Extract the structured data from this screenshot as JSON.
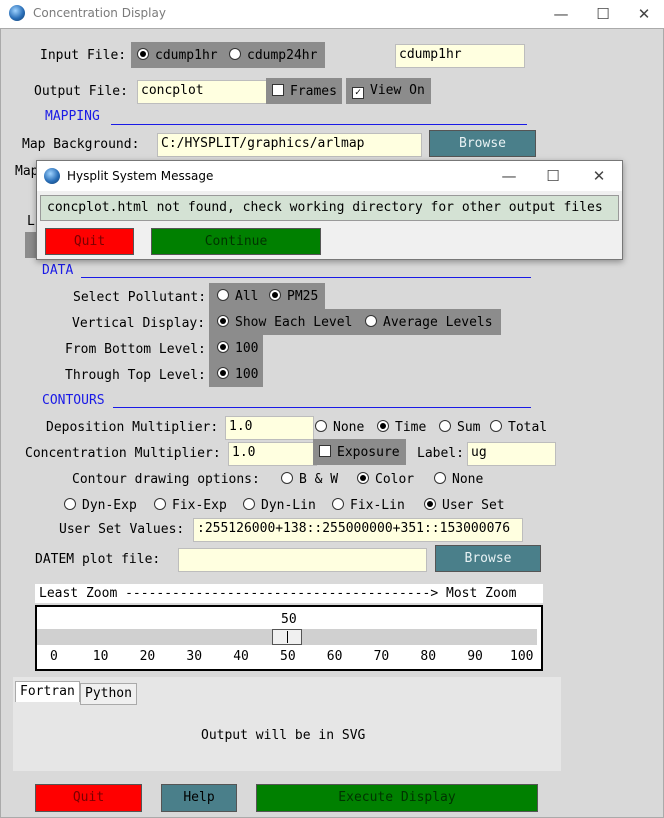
{
  "window": {
    "title": "Concentration Display",
    "minimize": "—",
    "maximize": "☐",
    "close": "✕"
  },
  "input": {
    "label": "Input File:",
    "options": [
      "cdump1hr",
      "cdump24hr"
    ],
    "selected": 0,
    "value": "cdump1hr"
  },
  "output": {
    "label": "Output File:",
    "value": "concplot",
    "frames_label": "Frames",
    "frames_checked": false,
    "viewon_label": "View On",
    "viewon_checked": true
  },
  "mapping": {
    "header": "MAPPING",
    "background_label": "Map Background:",
    "background_value": "C:/HYSPLIT/graphics/arlmap",
    "browse": "Browse",
    "partial1": "Map",
    "partial2": "L"
  },
  "dialog": {
    "title": "Hysplit System Message",
    "message": "concplot.html not found, check working directory for other output files",
    "quit": "Quit",
    "continue": "Continue"
  },
  "data": {
    "header": "DATA",
    "pollutant_label": "Select Pollutant:",
    "pollutant_options": [
      "All",
      "PM25"
    ],
    "pollutant_selected": 1,
    "vertical_label": "Vertical Display:",
    "vertical_options": [
      "Show Each Level",
      "Average Levels"
    ],
    "vertical_selected": 0,
    "bottom_label": "From Bottom Level:",
    "bottom_value": "100",
    "top_label": "Through Top Level:",
    "top_value": "100"
  },
  "contours": {
    "header": "CONTOURS",
    "deposition_label": "Deposition Multiplier:",
    "deposition_value": "1.0",
    "dep_options": [
      "None",
      "Time",
      "Sum",
      "Total"
    ],
    "dep_selected": 1,
    "conc_label": "Concentration Multiplier:",
    "conc_value": "1.0",
    "exposure_label": "Exposure",
    "exposure_checked": false,
    "label_label": "Label:",
    "label_value": "ug",
    "drawing_label": "Contour drawing options:",
    "drawing_options": [
      "B & W",
      "Color",
      "None"
    ],
    "drawing_selected": 1,
    "interval_options": [
      "Dyn-Exp",
      "Fix-Exp",
      "Dyn-Lin",
      "Fix-Lin",
      "User Set"
    ],
    "interval_selected": 4,
    "userset_label": "User Set Values:",
    "userset_value": ":255126000+138::255000000+351::153000076"
  },
  "datem": {
    "label": "DATEM plot file:",
    "value": "",
    "browse": "Browse"
  },
  "zoom": {
    "header": "Least Zoom ---------------------------------------> Most Zoom",
    "value": "50",
    "value_fraction": 0.5,
    "ticks": [
      "0",
      "10",
      "20",
      "30",
      "40",
      "50",
      "60",
      "70",
      "80",
      "90",
      "100"
    ]
  },
  "tabs": {
    "items": [
      "Fortran",
      "Python"
    ],
    "active": 0,
    "content": "Output will be in SVG"
  },
  "footer": {
    "quit": "Quit",
    "help": "Help",
    "execute": "Execute Display"
  },
  "colors": {
    "red": "#ff0000",
    "green": "#008000",
    "teal": "#4a7f8a",
    "section_blue": "#1a1ae6",
    "entry_bg": "#ffffe0"
  }
}
